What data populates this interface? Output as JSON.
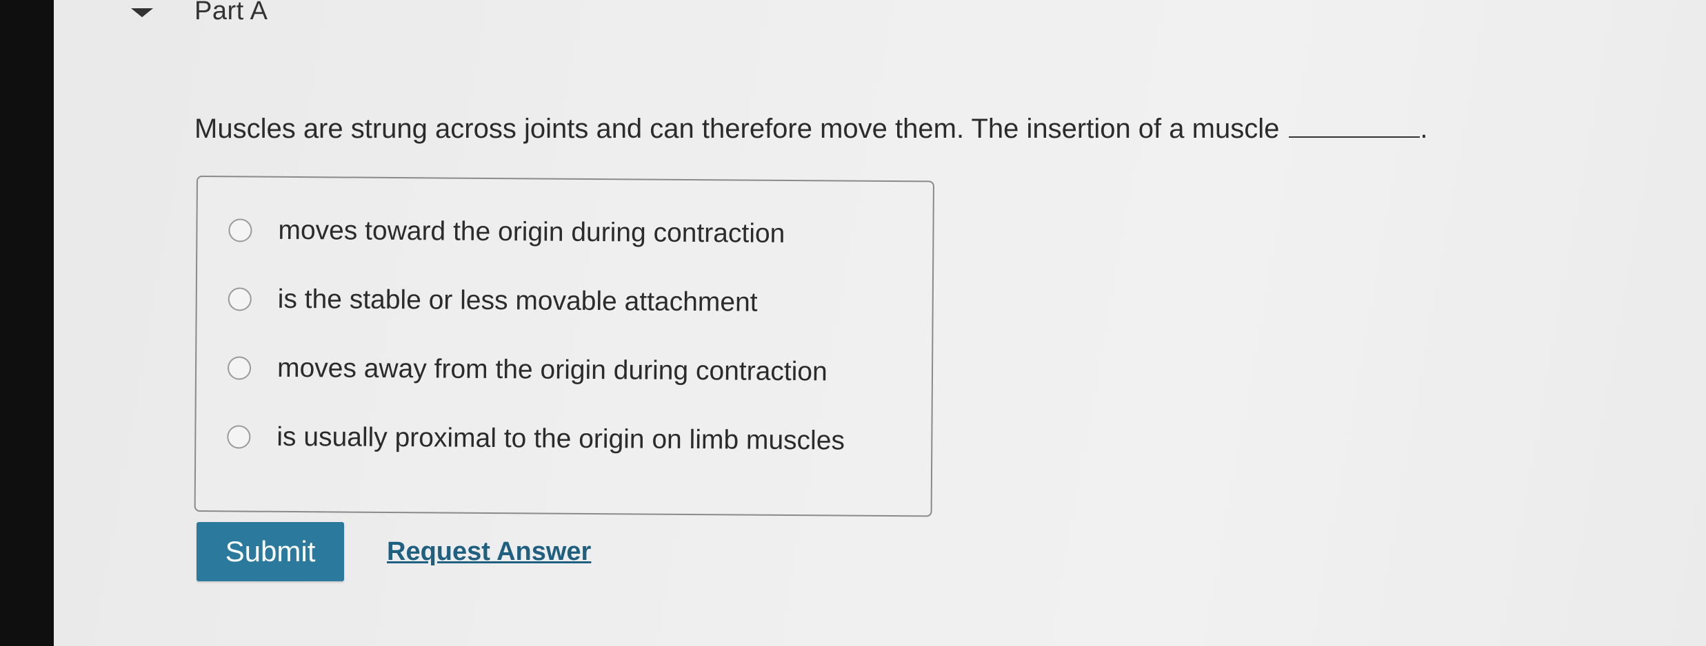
{
  "part": {
    "title": "Part A"
  },
  "question": {
    "text": "Muscles are strung across joints and can therefore move them. The insertion of a muscle",
    "end_punct": "."
  },
  "choices": [
    {
      "label": "moves toward the origin during contraction"
    },
    {
      "label": "is the stable or less movable attachment"
    },
    {
      "label": "moves away from the origin during contraction"
    },
    {
      "label": "is usually proximal to the origin on limb muscles"
    }
  ],
  "actions": {
    "submit_label": "Submit",
    "request_label": "Request Answer"
  },
  "colors": {
    "submit_bg": "#2b7a9e",
    "link": "#1f5f80"
  }
}
